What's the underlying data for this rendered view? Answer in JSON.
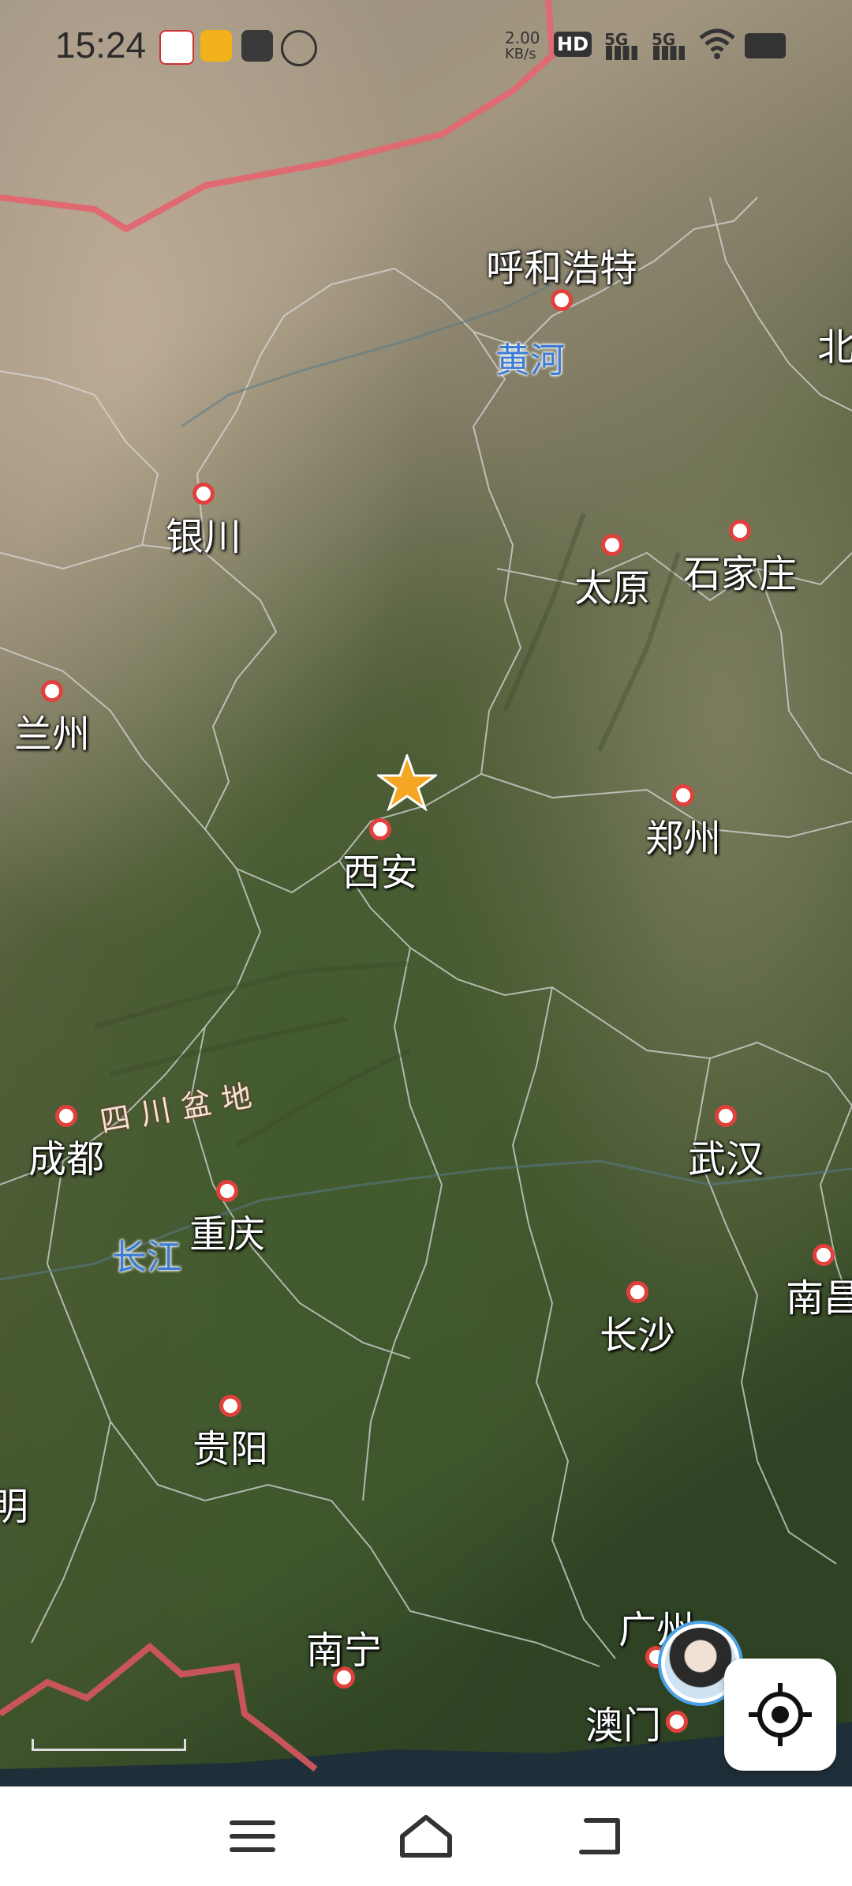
{
  "status_bar": {
    "time": "15:24",
    "net_speed": "2.00",
    "net_unit": "KB/s",
    "hd_label": "HD",
    "signal_1": "5G",
    "signal_2": "5G"
  },
  "map": {
    "cities": [
      {
        "name": "呼和浩特"
      },
      {
        "name": "银川"
      },
      {
        "name": "太原"
      },
      {
        "name": "石家庄"
      },
      {
        "name": "兰州"
      },
      {
        "name": "西安"
      },
      {
        "name": "郑州"
      },
      {
        "name": "成都"
      },
      {
        "name": "重庆"
      },
      {
        "name": "武汉"
      },
      {
        "name": "长沙"
      },
      {
        "name": "南昌"
      },
      {
        "name": "贵阳"
      },
      {
        "name": "明"
      },
      {
        "name": "南宁"
      },
      {
        "name": "广州"
      },
      {
        "name": "澳门"
      },
      {
        "name": "北"
      }
    ],
    "rivers": [
      "黄河",
      "长江"
    ],
    "regions": [
      "四川盆地"
    ],
    "marker_icon": "star-marker-icon",
    "marker_color": "#f5a623",
    "city_dot_color": "#e0413c",
    "river_label_color": "#3a7bd5",
    "border_color": "#e06a72"
  },
  "controls": {
    "locate_icon": "locate-crosshair-icon",
    "avatar_icon": "user-avatar-icon"
  },
  "navbar": {
    "items": [
      "menu-icon",
      "home-icon",
      "back-icon"
    ]
  }
}
